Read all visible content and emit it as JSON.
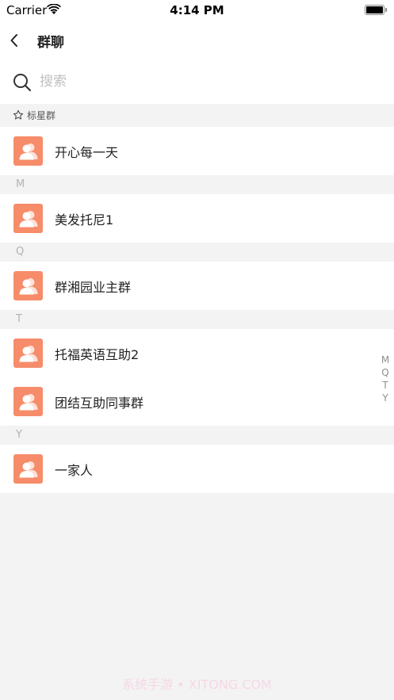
{
  "status_bar": {
    "carrier": "Carrier",
    "time": "4:14 PM"
  },
  "nav": {
    "title": "群聊"
  },
  "search": {
    "placeholder": "搜索"
  },
  "starred": {
    "title": "标星群",
    "items": [
      {
        "label": "开心每一天"
      }
    ]
  },
  "sections": [
    {
      "letter": "M",
      "items": [
        {
          "label": "美发托尼1"
        }
      ]
    },
    {
      "letter": "Q",
      "items": [
        {
          "label": "群湘园业主群"
        }
      ]
    },
    {
      "letter": "T",
      "items": [
        {
          "label": "托福英语互助2"
        },
        {
          "label": "团结互助同事群"
        }
      ]
    },
    {
      "letter": "Y",
      "items": [
        {
          "label": "一家人"
        }
      ]
    }
  ],
  "index_letters": [
    "M",
    "Q",
    "T",
    "Y"
  ],
  "watermark": "系统手游 • XITONG.COM",
  "colors": {
    "avatar_bg": "#f68c6a",
    "background": "#f3f3f3"
  }
}
